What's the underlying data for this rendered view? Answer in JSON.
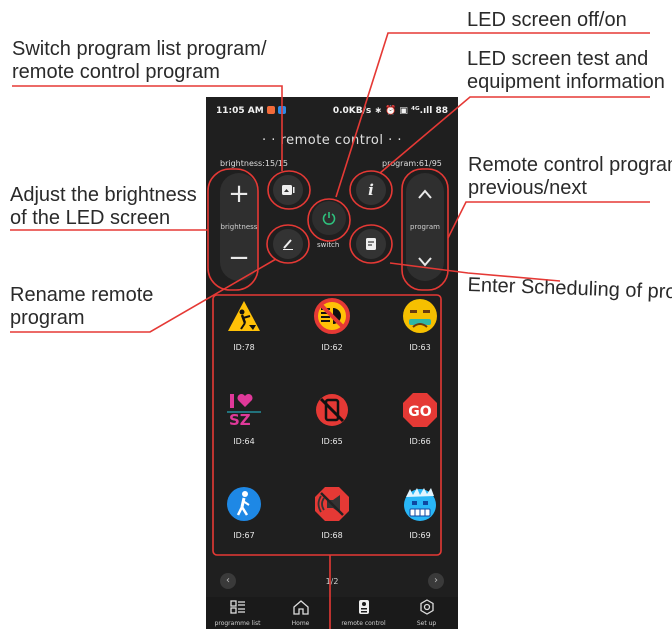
{
  "annotations": {
    "led_onoff": "LED screen off/on",
    "switch_list_1": "Switch program list program/",
    "switch_list_2": "remote control program",
    "led_test_1": "LED screen test and",
    "led_test_2": "equipment information",
    "prev_next_1": "Remote control program",
    "prev_next_2": "previous/next",
    "brightness_1": "Adjust the brightness",
    "brightness_2": "of the LED screen",
    "rename_1": "Rename remote",
    "rename_2": "program",
    "scheduling": "Enter Scheduling of program"
  },
  "status_bar": {
    "time": "11:05 AM",
    "right": "0.0KB/s ∗ ⏰ ▣ ⁴ᴳ.ıll 88"
  },
  "screen": {
    "title": "· · remote control · ·",
    "brightness_label": "brightness:15/15",
    "program_label": "program:61/95",
    "brightness_word": "brightness",
    "program_word": "program",
    "switch_word": "switch"
  },
  "programs": [
    {
      "id": "ID:78",
      "icon": "road-work-icon"
    },
    {
      "id": "ID:62",
      "icon": "no-high-beam-icon"
    },
    {
      "id": "ID:63",
      "icon": "sad-face-icon"
    },
    {
      "id": "ID:64",
      "icon": "i-love-sz-icon"
    },
    {
      "id": "ID:65",
      "icon": "no-phone-icon"
    },
    {
      "id": "ID:66",
      "icon": "go-sign-icon"
    },
    {
      "id": "ID:67",
      "icon": "pedestrian-icon"
    },
    {
      "id": "ID:68",
      "icon": "no-horn-icon"
    },
    {
      "id": "ID:69",
      "icon": "frozen-face-icon"
    }
  ],
  "pager": {
    "page": "1/2"
  },
  "nav": [
    {
      "label": "programme list",
      "icon": "list-icon"
    },
    {
      "label": "Home",
      "icon": "home-icon"
    },
    {
      "label": "remote control",
      "icon": "remote-icon"
    },
    {
      "label": "Set up",
      "icon": "gear-icon"
    }
  ],
  "colors": {
    "accent_red": "#e53935",
    "power_green": "#2ec27e",
    "screen_bg": "#1f1f1f"
  }
}
